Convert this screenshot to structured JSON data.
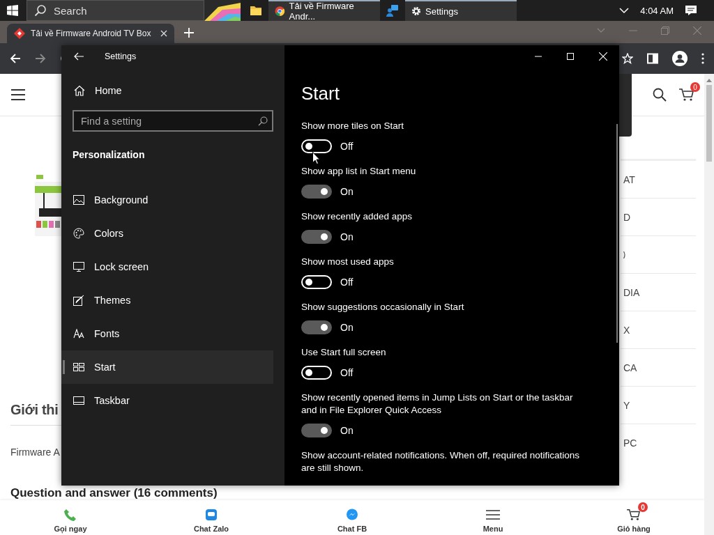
{
  "taskbar": {
    "search_placeholder": "Search",
    "apps": [
      {
        "kind": "folder"
      },
      {
        "kind": "chrome",
        "label": "Tải về Firmware Andr..."
      },
      {
        "kind": "people"
      },
      {
        "kind": "gear",
        "label": "Settings"
      }
    ],
    "clock": "4:04 AM"
  },
  "browser": {
    "tab_title": "Tải về Firmware Android TV Box",
    "cart_count": "0"
  },
  "page": {
    "heading": "Giới thi",
    "paragraph": "Firmware A",
    "comments": "Question and answer (16 comments)",
    "side_menu": [
      {
        "text": "AT"
      },
      {
        "text": "D"
      },
      {
        "kind": "cut"
      },
      {
        "text": "DIA"
      },
      {
        "text": "X"
      },
      {
        "text": "CA"
      },
      {
        "text": "Y"
      },
      {
        "text": "PC"
      }
    ],
    "bottom_nav": [
      {
        "kind": "phone",
        "label": "Gọi ngay"
      },
      {
        "kind": "zalo",
        "label": "Chat Zalo"
      },
      {
        "kind": "messenger",
        "label": "Chat FB"
      },
      {
        "kind": "menu",
        "label": "Menu"
      },
      {
        "kind": "cart",
        "label": "Giỏ hàng",
        "badge": "0"
      }
    ]
  },
  "settings": {
    "title": "Settings",
    "home": "Home",
    "search_placeholder": "Find a setting",
    "section": "Personalization",
    "nav": [
      {
        "kind": "picture",
        "label": "Background",
        "selected": false
      },
      {
        "kind": "palette",
        "label": "Colors",
        "selected": false
      },
      {
        "kind": "monitor",
        "label": "Lock screen",
        "selected": false
      },
      {
        "kind": "brush",
        "label": "Themes",
        "selected": false
      },
      {
        "kind": "fonts",
        "label": "Fonts",
        "selected": false
      },
      {
        "kind": "start",
        "label": "Start",
        "selected": true
      },
      {
        "kind": "taskbar",
        "label": "Taskbar",
        "selected": false
      }
    ],
    "page_title": "Start",
    "options": [
      {
        "label": "Show more tiles on Start",
        "on": false,
        "state": "Off"
      },
      {
        "label": "Show app list in Start menu",
        "on": true,
        "state": "On"
      },
      {
        "label": "Show recently added apps",
        "on": true,
        "state": "On"
      },
      {
        "label": "Show most used apps",
        "on": false,
        "state": "Off"
      },
      {
        "label": "Show suggestions occasionally in Start",
        "on": true,
        "state": "On"
      },
      {
        "label": "Use Start full screen",
        "on": false,
        "state": "Off"
      },
      {
        "label": "Show recently opened items in Jump Lists on Start or the taskbar and in File Explorer Quick Access",
        "on": true,
        "state": "On"
      },
      {
        "label": "Show account-related notifications. When off, required notifications are still shown."
      }
    ]
  }
}
